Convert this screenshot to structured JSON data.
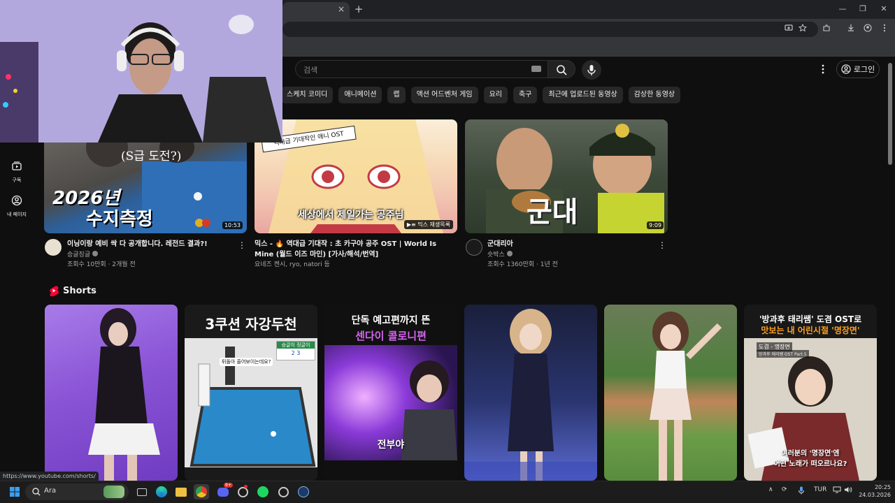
{
  "browser": {
    "tab_close": "×",
    "new_tab": "+",
    "window_controls": [
      "—",
      "❐",
      "✕"
    ],
    "status_url": "https://www.youtube.com/shorts/"
  },
  "header": {
    "search_placeholder": "검색",
    "login_label": "로그인",
    "icons": [
      "search-icon",
      "mic-icon",
      "more-vert-icon",
      "account-icon"
    ]
  },
  "chips": [
    "스케치 코미디",
    "애니메이션",
    "랩",
    "액션 어드벤처 게임",
    "요리",
    "축구",
    "최근에 업로드된 동영상",
    "감상한 동영상"
  ],
  "sidebar": {
    "items": [
      {
        "label": "구독",
        "icon": "subscriptions-icon"
      },
      {
        "label": "내 페이지",
        "icon": "account-circle-icon"
      }
    ]
  },
  "videos": [
    {
      "thumb_text_1": "(S급 도전?)",
      "thumb_text_2": "2026년",
      "thumb_text_3": "수지측정",
      "duration": "10:53",
      "title": "이닝이랑 예비 싹 다 공개합니다. 레전드 결과?!",
      "channel": "승글징글",
      "meta": "조회수 10만회 · 2개월 전"
    },
    {
      "thumb_text_1": "역대급 기대작인 애니 OST",
      "thumb_text_2": "세상에서 제일가는 공주님",
      "mix_badge": "믹스 재생목록",
      "title": "믹스 - 🔥 역대급 기대작 : 초 카구야 공주 OST | World Is Mine (월드 이즈 마인) [가사/해석/번역]",
      "channel": "요네즈 켄시, ryo, natori 등"
    },
    {
      "thumb_text_1": "군대",
      "duration": "9:09",
      "title": "군대리아",
      "channel": "숏박스",
      "meta": "조회수 1360만회 · 1년 전"
    }
  ],
  "shorts": {
    "title": "Shorts",
    "items": [
      {
        "headline": ""
      },
      {
        "headline": "3쿠션 자강두천",
        "sub": "뒤돌아 줄어보이는데요?",
        "score_title": "승글이 징글이",
        "score": "2 3"
      },
      {
        "headline": "단독 예고편까지 뜬",
        "headline2": "센다이 콜로니편",
        "caption": "전부야"
      },
      {
        "headline": ""
      },
      {
        "headline": ""
      },
      {
        "headline": "'방과후 태리쌤' 도겸 OST로",
        "headline2": "맛보는 내 어린시절 '명장면'",
        "tag": "도겸 - 명장면",
        "tag2": "방과후 태리쌤 OST Part.5",
        "caption": "여러분의 '명장면'엔",
        "caption2": "어떤 노래가 떠오르나요?"
      }
    ]
  },
  "taskbar": {
    "search_text": "Ara",
    "lang": "TUR",
    "time": "20:25",
    "date": "24.03.2026",
    "discord_badge": "9+"
  }
}
